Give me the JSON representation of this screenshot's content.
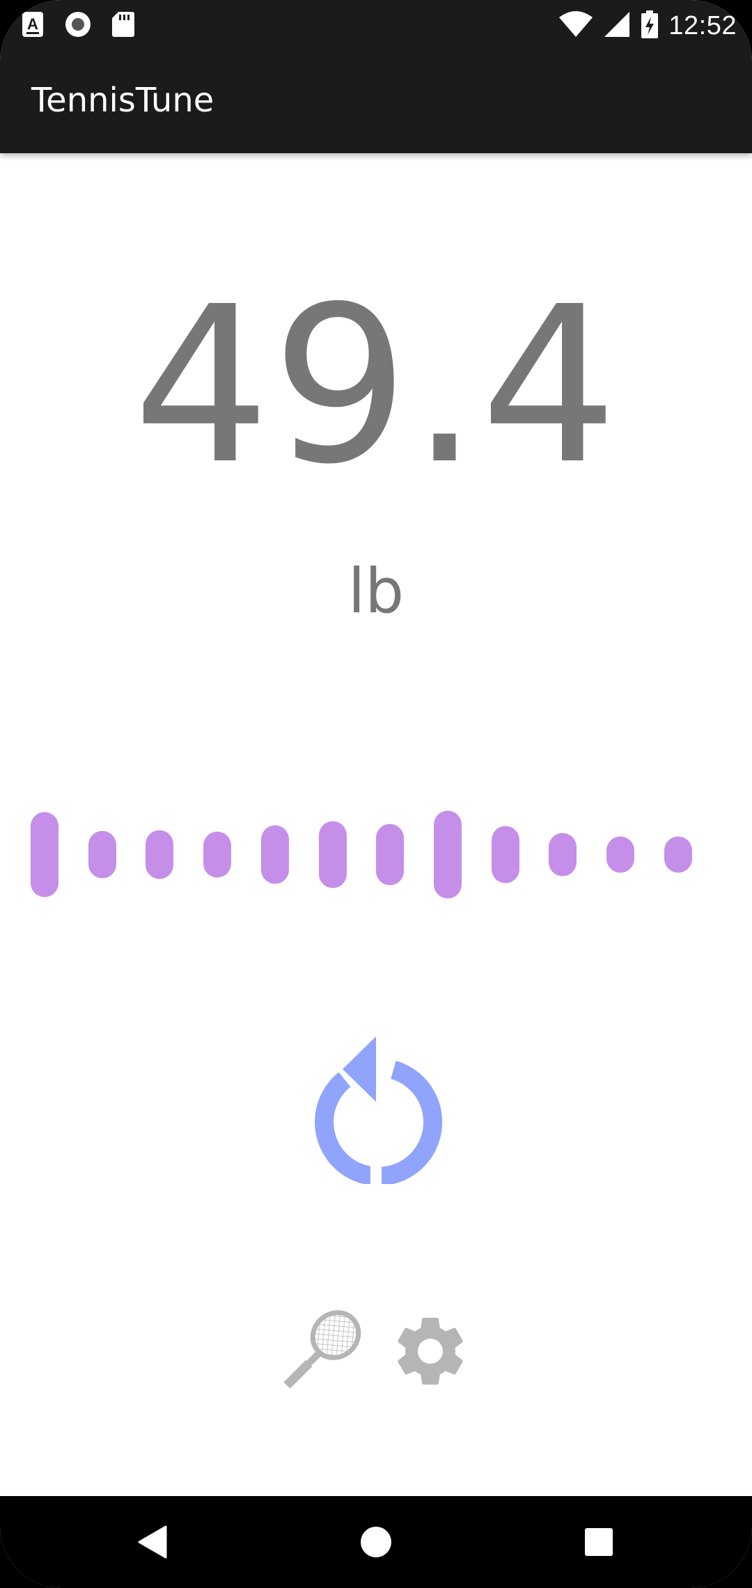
{
  "status_bar": {
    "time": "12:52",
    "left_icons": [
      "accessibility-a-icon",
      "record-icon",
      "sd-card-icon"
    ],
    "right_icons": [
      "wifi-icon",
      "cell-signal-icon",
      "battery-charging-icon"
    ]
  },
  "app_bar": {
    "title": "TennisTune"
  },
  "reading": {
    "value": "49.4",
    "unit": "lb"
  },
  "meter": {
    "color": "#c58fe9",
    "levels": [
      0.9,
      0.5,
      0.52,
      0.48,
      0.62,
      0.7,
      0.65,
      0.92,
      0.6,
      0.45,
      0.38,
      0.38
    ]
  },
  "controls": {
    "refresh_icon": "refresh-icon",
    "refresh_color": "#90a4fc",
    "racket_icon": "tennis-racket-icon",
    "settings_icon": "gear-icon",
    "icon_color": "#b5b5b5"
  },
  "nav_bar": {
    "icons": [
      "back-icon",
      "home-icon",
      "recents-icon"
    ]
  }
}
